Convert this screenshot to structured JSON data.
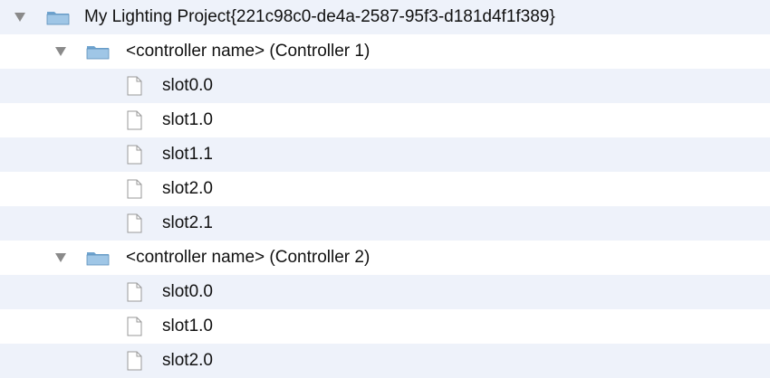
{
  "tree": {
    "root": {
      "label": "My Lighting Project{221c98c0-de4a-2587-95f3-d181d4f1f389}",
      "icon": "folder-icon",
      "expanded": true
    },
    "controllers": [
      {
        "label": "<controller name> (Controller 1)",
        "icon": "folder-icon",
        "expanded": true,
        "slots": [
          {
            "label": "slot0.0",
            "icon": "file-icon"
          },
          {
            "label": "slot1.0",
            "icon": "file-icon"
          },
          {
            "label": "slot1.1",
            "icon": "file-icon"
          },
          {
            "label": "slot2.0",
            "icon": "file-icon"
          },
          {
            "label": "slot2.1",
            "icon": "file-icon"
          }
        ]
      },
      {
        "label": "<controller name> (Controller 2)",
        "icon": "folder-icon",
        "expanded": true,
        "slots": [
          {
            "label": "slot0.0",
            "icon": "file-icon"
          },
          {
            "label": "slot1.0",
            "icon": "file-icon"
          },
          {
            "label": "slot2.0",
            "icon": "file-icon"
          }
        ]
      }
    ]
  },
  "colors": {
    "alt_row": "#eef2fa",
    "folder_top": "#9fc6e6",
    "folder_body": "#6ea3cf",
    "disclosure": "#8a8a8a"
  }
}
